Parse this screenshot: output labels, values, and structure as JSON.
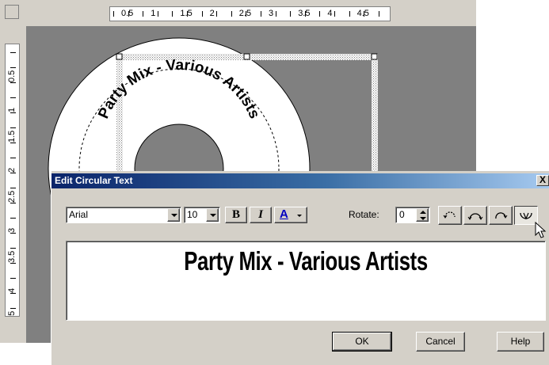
{
  "editor": {
    "top_ruler_labels": [
      "0.5",
      "1",
      "1.5",
      "2",
      "2.5",
      "3",
      "3.5",
      "4",
      "4.5"
    ],
    "left_ruler_labels": [
      "0.5",
      "1",
      "1.5",
      "2",
      "2.5",
      "3",
      "3.5",
      "4",
      "4.5"
    ],
    "canvas_color": "#808080",
    "disc_curved_text": "Party Mix - Various Artists"
  },
  "dialog": {
    "title": "Edit Circular Text",
    "close_label": "X",
    "font": {
      "value": "Arial"
    },
    "size": {
      "value": "10"
    },
    "bold_label": "B",
    "italic_label": "I",
    "color_label": "A",
    "rotate_label": "Rotate:",
    "rotate_value": "0",
    "preview_text": "Party Mix - Various Artists",
    "buttons": {
      "ok": "OK",
      "cancel": "Cancel",
      "help": "Help"
    },
    "colors": {
      "title_start": "#0a246a",
      "title_end": "#a6caf0",
      "face": "#d4d0c8"
    }
  }
}
